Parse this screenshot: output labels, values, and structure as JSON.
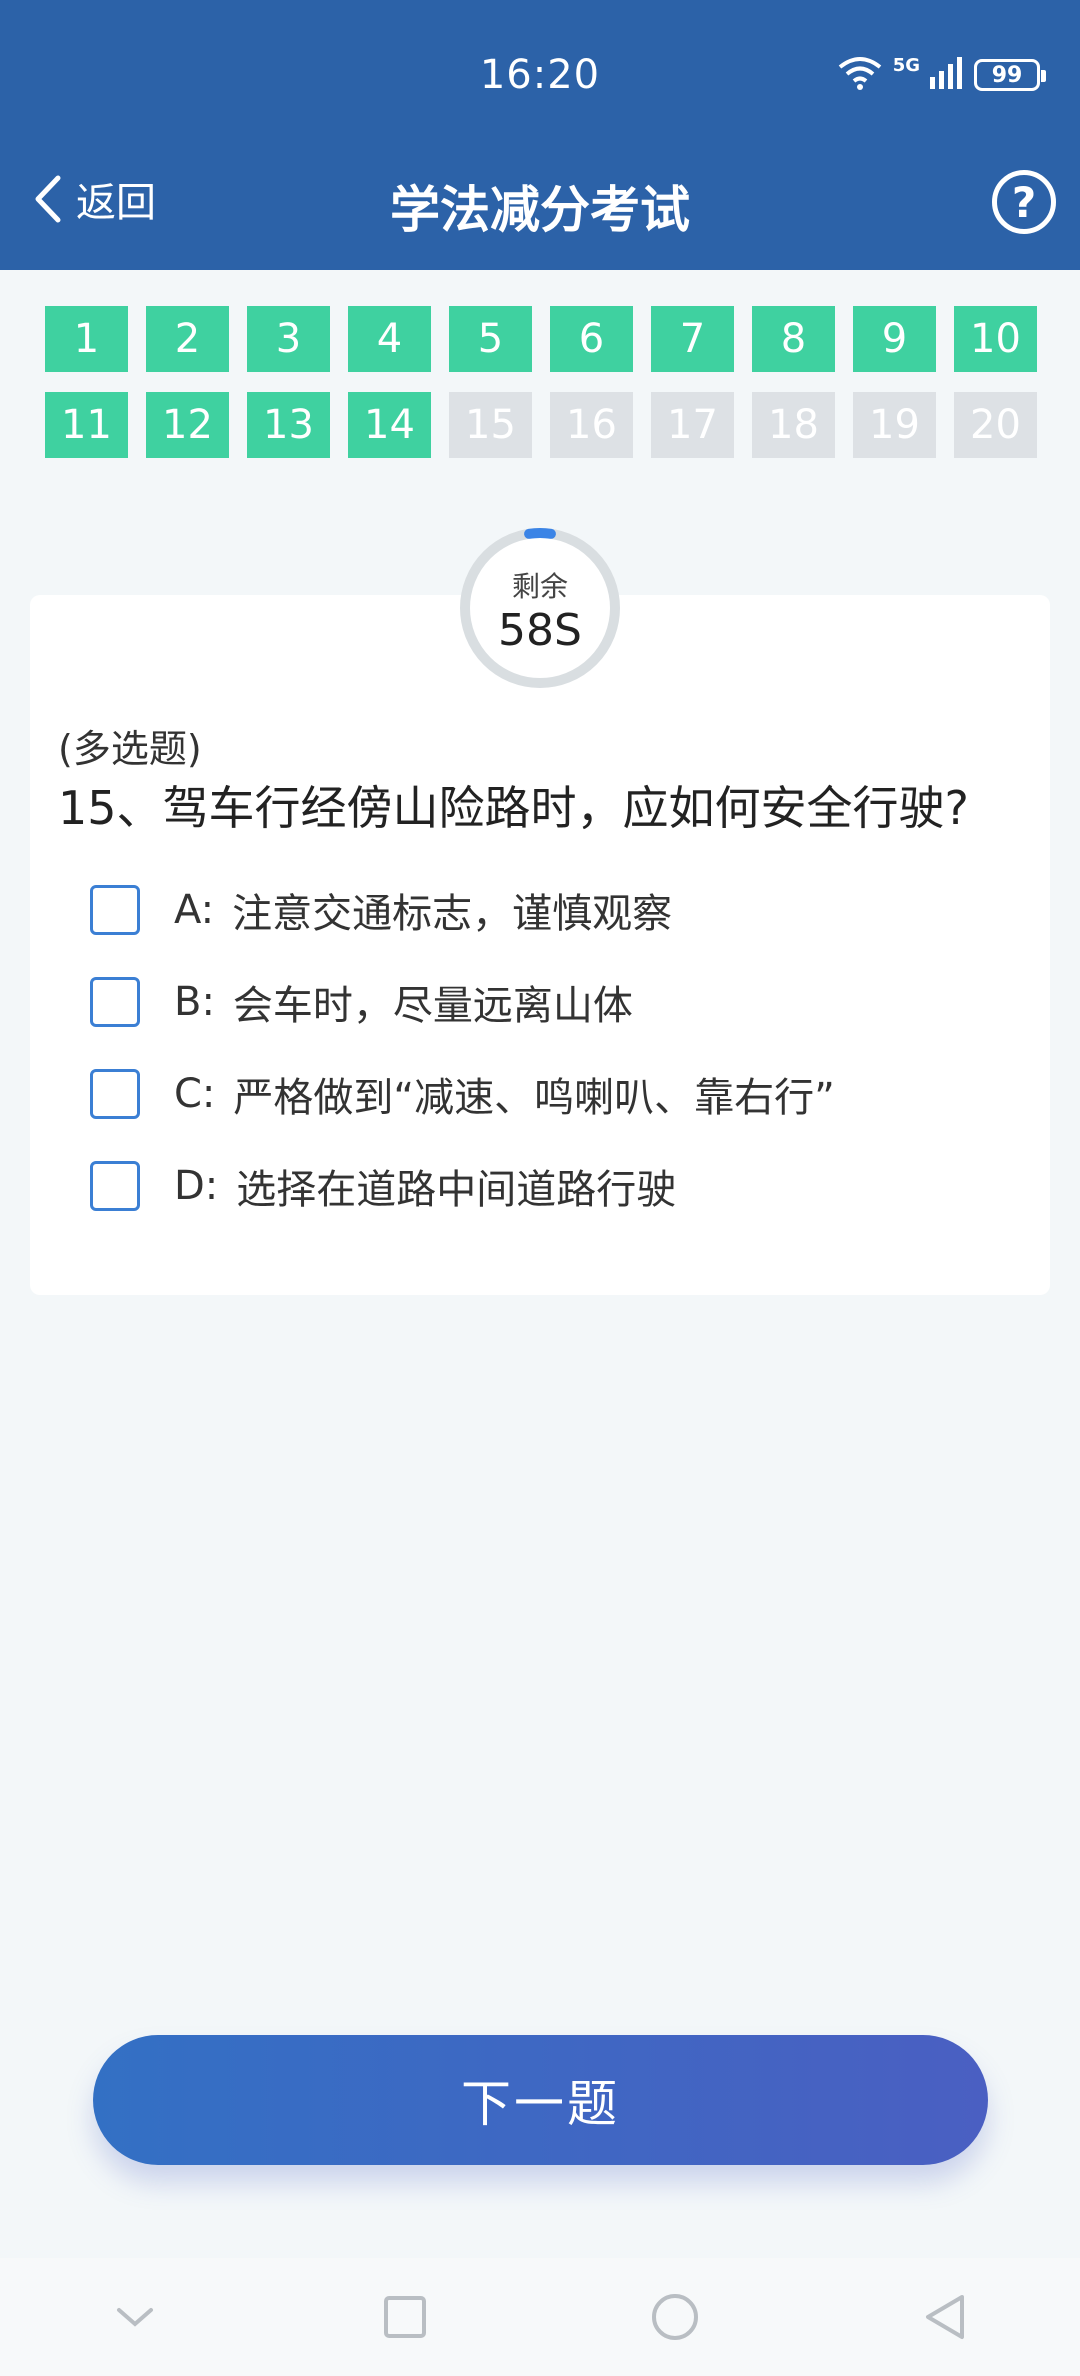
{
  "status_bar": {
    "time": "16:20",
    "battery": "99",
    "network": "5G"
  },
  "header": {
    "back_label": "返回",
    "title": "学法减分考试",
    "help_symbol": "?"
  },
  "progress": {
    "answered": [
      "1",
      "2",
      "3",
      "4",
      "5",
      "6",
      "7",
      "8",
      "9",
      "10",
      "11",
      "12",
      "13",
      "14"
    ],
    "remaining": [
      "15",
      "16",
      "17",
      "18",
      "19",
      "20"
    ]
  },
  "timer": {
    "label": "剩余",
    "value": "58S",
    "fraction_remaining": 0.97
  },
  "question": {
    "type": "(多选题)",
    "text": "15、驾车行经傍山险路时，应如何安全行驶?",
    "options": [
      {
        "letter": "A:",
        "text": "注意交通标志，谨慎观察"
      },
      {
        "letter": "B:",
        "text": "会车时，尽量远离山体"
      },
      {
        "letter": "C:",
        "text": "严格做到“减速、鸣喇叭、靠右行”"
      },
      {
        "letter": "D:",
        "text": "选择在道路中间道路行驶"
      }
    ]
  },
  "next_button": {
    "label": "下一题"
  },
  "colors": {
    "header": "#2c62a8",
    "done": "#3fd1a0",
    "todo": "#dde1e5",
    "accent": "#3b7fd4"
  },
  "nav_icons": [
    "chevron-down-icon",
    "recent-apps-icon",
    "home-icon",
    "back-icon"
  ]
}
